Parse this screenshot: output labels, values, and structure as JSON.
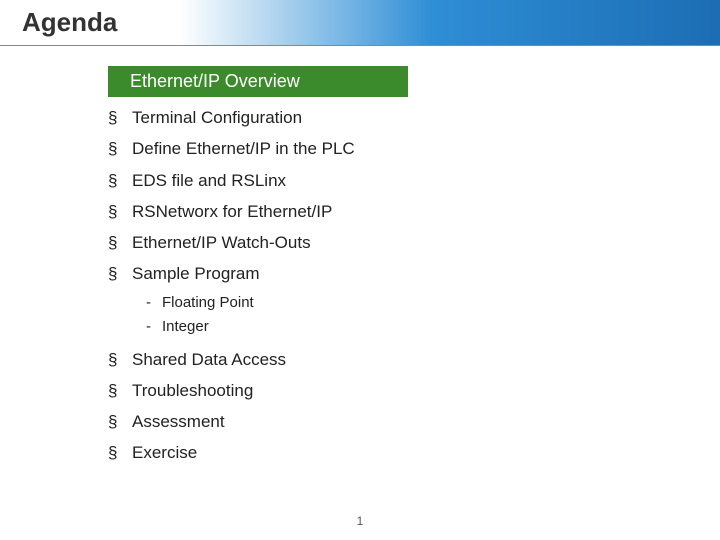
{
  "title": "Agenda",
  "highlight": "Ethernet/IP Overview",
  "items": [
    {
      "label": "Terminal Configuration"
    },
    {
      "label": "Define Ethernet/IP in the PLC"
    },
    {
      "label": "EDS file and RSLinx"
    },
    {
      "label": "RSNetworx for Ethernet/IP"
    },
    {
      "label": "Ethernet/IP Watch-Outs"
    },
    {
      "label": "Sample Program",
      "sub": [
        "Floating Point",
        "Integer"
      ]
    },
    {
      "label": "Shared Data Access"
    },
    {
      "label": "Troubleshooting"
    },
    {
      "label": "Assessment"
    },
    {
      "label": "Exercise"
    }
  ],
  "page": "1"
}
